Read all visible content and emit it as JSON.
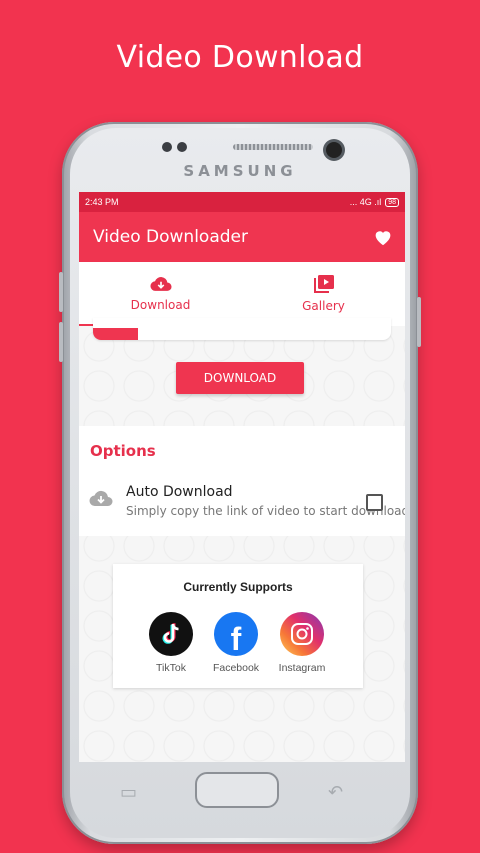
{
  "headline": "Video Download",
  "device": {
    "brand": "SAMSUNG"
  },
  "status_bar": {
    "time": "2:43 PM",
    "signal_text": "... 4G .ıl",
    "battery": "98"
  },
  "app_bar": {
    "title": "Video Downloader",
    "favorite_icon": "heart-icon"
  },
  "tabs": [
    {
      "label": "Download",
      "icon": "cloud-download-icon",
      "active": true
    },
    {
      "label": "Gallery",
      "icon": "video-library-icon",
      "active": false
    }
  ],
  "download_button": {
    "label": "DOWNLOAD"
  },
  "options": {
    "title": "Options",
    "items": [
      {
        "label": "Auto Download",
        "description": "Simply copy the link of video to start download",
        "checked": false,
        "icon": "cloud-download-icon"
      }
    ]
  },
  "supports": {
    "title": "Currently Supports",
    "platforms": [
      {
        "name": "TikTok",
        "icon": "tiktok-icon"
      },
      {
        "name": "Facebook",
        "icon": "facebook-icon"
      },
      {
        "name": "Instagram",
        "icon": "instagram-icon"
      }
    ]
  },
  "colors": {
    "accent": "#ef3550",
    "background": "#f2334f",
    "status_bar": "#d9223f"
  }
}
